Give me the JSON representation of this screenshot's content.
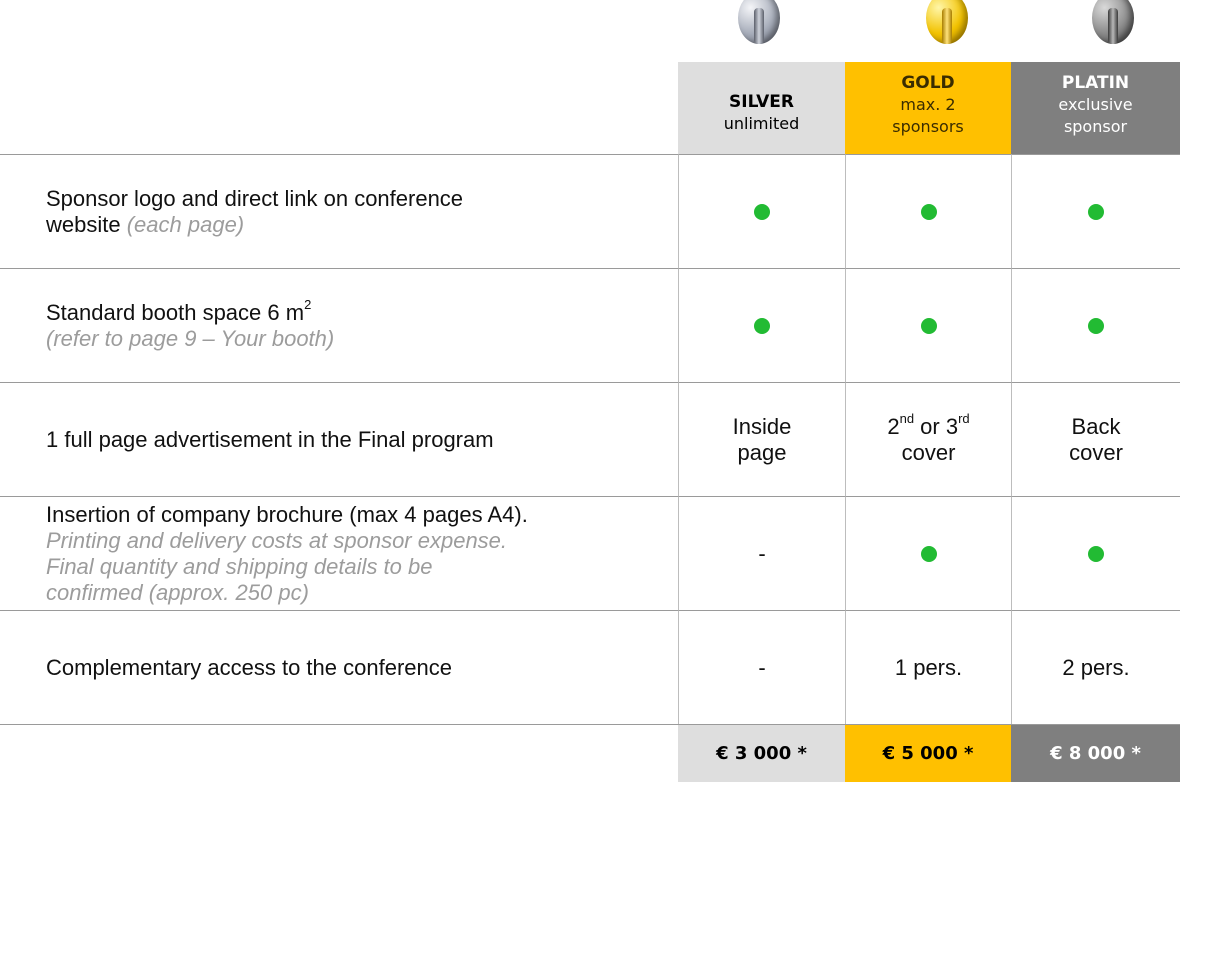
{
  "tiers": [
    {
      "title": "SILVER",
      "subtitle": "unlimited",
      "price": "€ 3 000 *",
      "color": "#dedede"
    },
    {
      "title": "GOLD",
      "subtitle": "max. 2 sponsors",
      "price": "€ 5 000 *",
      "color": "#ffc000"
    },
    {
      "title": "PLATIN",
      "subtitle": "exclusive sponsor",
      "price": "€ 8 000 *",
      "color": "#7f7f7f"
    }
  ],
  "rows": [
    {
      "label_line1": "Sponsor logo and direct link on conference",
      "label_line2": "website",
      "note": "(each page)",
      "values": [
        "dot",
        "dot",
        "dot"
      ]
    },
    {
      "label": "Standard booth space 6 m",
      "label_sup": "2",
      "note": "(refer to page 9 – Your booth)",
      "values": [
        "dot",
        "dot",
        "dot"
      ]
    },
    {
      "label": "1 full page advertisement in the Final program",
      "silver_line1": "Inside",
      "silver_line2": "page",
      "gold_a": "2",
      "gold_a_sup": "nd",
      "gold_or": " or 3",
      "gold_b_sup": "rd",
      "gold_line2": "cover",
      "platin_line1": "Back",
      "platin_line2": "cover"
    },
    {
      "label": "Insertion of company brochure (max 4 pages A4).",
      "note_line1": "Printing and delivery costs at sponsor expense.",
      "note_line2": "Final quantity and shipping details to be",
      "note_line3": "confirmed (approx. 250 pc)",
      "silver_value": "-",
      "values": [
        "-",
        "dot",
        "dot"
      ]
    },
    {
      "label": "Complementary access to the conference",
      "values": [
        "-",
        "1 pers.",
        "2 pers."
      ]
    }
  ],
  "icons": [
    "silver-coin-icon",
    "gold-coin-icon",
    "platin-coin-icon",
    "check-dot-icon"
  ],
  "colors": {
    "check": "#22bb33",
    "note": "#9c9c9c"
  }
}
